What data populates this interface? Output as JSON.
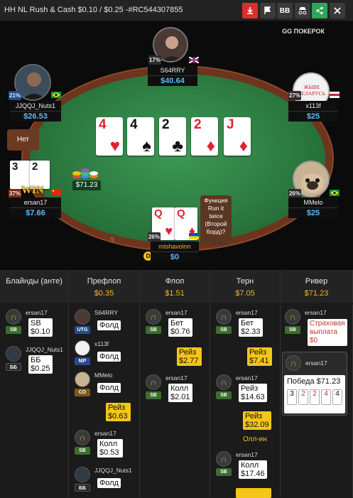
{
  "header": {
    "title": "HH NL Rush & Cash $0.10 / $0.25 -#RC544307855",
    "buttons": [
      {
        "name": "download",
        "icon": "download-icon",
        "color": "#d9302b",
        "label": ""
      },
      {
        "name": "report",
        "icon": "flag-icon",
        "color": "#3a3a3a",
        "label": ""
      },
      {
        "name": "bb",
        "icon": "",
        "color": "#3a3a3a",
        "label": "BB"
      },
      {
        "name": "spy",
        "icon": "incognito-icon",
        "color": "#3a3a3a",
        "label": ""
      },
      {
        "name": "share",
        "icon": "share-icon",
        "color": "#2fa55a",
        "label": ""
      },
      {
        "name": "close",
        "icon": "close-icon",
        "color": "#3a3a3a",
        "label": ""
      }
    ]
  },
  "table": {
    "brand": "GG ПОКЕРОК",
    "rail_text": "$",
    "board": [
      {
        "rank": "4",
        "suit": "♥",
        "color": "red"
      },
      {
        "rank": "4",
        "suit": "♠",
        "color": "black"
      },
      {
        "rank": "2",
        "suit": "♣",
        "color": "black"
      },
      {
        "rank": "2",
        "suit": "♦",
        "color": "red"
      },
      {
        "rank": "J",
        "suit": "♦",
        "color": "red"
      }
    ],
    "pot": "$71.23",
    "bubble_left": "Нет",
    "bubble_runtwice": "Функция Run it twice (Второй борд)?",
    "players": {
      "top": {
        "name": "S64RRY",
        "stack": "$40.64",
        "pct": "17%"
      },
      "topright": {
        "name": "x113f",
        "stack": "$25",
        "pct": "27%",
        "avatar_text": "ЖЫВЕ БЕЛАРУСЬ"
      },
      "topleft": {
        "name": "JJQQJ_Nuts1",
        "stack": "$26.53",
        "pct": "21%"
      },
      "left": {
        "name": "ersan17",
        "stack": "$7.66",
        "pct": "37%",
        "cards": [
          "3",
          "2"
        ]
      },
      "right": {
        "name": "MMelo",
        "stack": "$25",
        "pct": "26%"
      },
      "hero": {
        "name": "mishavoinn",
        "stack": "$0",
        "pct": "26%",
        "cards": [
          "Q",
          "Q"
        ]
      }
    }
  },
  "streets": [
    {
      "label": "Блайнды (анте)",
      "value": ""
    },
    {
      "label": "Префлоп",
      "value": "$0.35"
    },
    {
      "label": "Флоп",
      "value": "$1.51"
    },
    {
      "label": "Терн",
      "value": "$7.05"
    },
    {
      "label": "Ривер",
      "value": "$71.23"
    }
  ],
  "actions": {
    "blinds": [
      {
        "name": "ersan17",
        "pos": "SB",
        "text": "SB $0.10"
      },
      {
        "name": "JJQQJ_Nuts1",
        "pos": "ББ",
        "text": "ББ $0.25"
      }
    ],
    "preflop": [
      {
        "name": "S64RRY",
        "pos": "UTG",
        "text": "Фолд"
      },
      {
        "name": "x113f",
        "pos": "MP",
        "text": "Фолд"
      },
      {
        "name": "MMelo",
        "pos": "CO",
        "text": "Фолд"
      },
      {
        "name": "",
        "pos": "",
        "text": "Рейз $0.63"
      },
      {
        "name": "ersan17",
        "pos": "SB",
        "text": "Колл $0.53"
      },
      {
        "name": "JJQQJ_Nuts1",
        "pos": "ББ",
        "text": "Фолд"
      }
    ],
    "flop": [
      {
        "name": "ersan17",
        "pos": "SB",
        "text": "Бет $0.76"
      },
      {
        "name": "",
        "pos": "",
        "text": "Рейз $2.77"
      },
      {
        "name": "ersan17",
        "pos": "SB",
        "text": "Колл $2.01"
      }
    ],
    "turn": [
      {
        "name": "ersan17",
        "pos": "SB",
        "text": "Бет $2.33"
      },
      {
        "name": "",
        "pos": "",
        "text": "Рейз $7.41"
      },
      {
        "name": "ersan17",
        "pos": "SB",
        "text": "Рейз $14.63"
      },
      {
        "name": "",
        "pos": "",
        "text": "Рейз $32.09"
      },
      {
        "name": "",
        "pos": "",
        "text": "Олл-ин"
      },
      {
        "name": "ersan17",
        "pos": "SB",
        "text": "Колл $17.46"
      }
    ],
    "river": [
      {
        "name": "ersan17",
        "pos": "SB",
        "text": "Страховая выплата $0"
      },
      {
        "name": "ersan17",
        "pos": "",
        "text": "Победа $71.23",
        "cards": [
          "3",
          "2",
          "2",
          "4",
          "4"
        ]
      }
    ]
  }
}
